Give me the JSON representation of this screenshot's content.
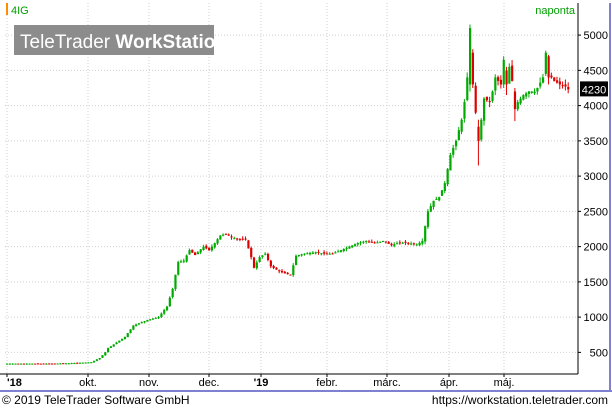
{
  "chart_data": {
    "type": "candlestick",
    "symbol": "4IG",
    "interval": "naponta",
    "watermark": {
      "brand_light": "TeleTrader ",
      "brand_bold": "WorkStation"
    },
    "last_value_label": "4230",
    "ylim": [
      250,
      5200
    ],
    "y_ticks": [
      500,
      1000,
      1500,
      2000,
      2500,
      3000,
      3500,
      4000,
      4500,
      5000
    ],
    "x_ticks": [
      {
        "label": "'18",
        "bold": true,
        "month_index": 0
      },
      {
        "label": "okt.",
        "bold": false,
        "month_index": 1
      },
      {
        "label": "nov.",
        "bold": false,
        "month_index": 2
      },
      {
        "label": "dec.",
        "bold": false,
        "month_index": 3
      },
      {
        "label": "'19",
        "bold": true,
        "month_index": 4
      },
      {
        "label": "febr.",
        "bold": false,
        "month_index": 5
      },
      {
        "label": "márc.",
        "bold": false,
        "month_index": 6
      },
      {
        "label": "ápr.",
        "bold": false,
        "month_index": 7
      },
      {
        "label": "máj.",
        "bold": false,
        "month_index": 8
      }
    ],
    "close_path": [
      [
        0,
        340
      ],
      [
        14,
        340
      ],
      [
        22,
        345
      ],
      [
        30,
        360
      ],
      [
        33,
        420
      ],
      [
        35,
        500
      ],
      [
        36,
        560
      ],
      [
        39,
        640
      ],
      [
        42,
        720
      ],
      [
        45,
        880
      ],
      [
        50,
        960
      ],
      [
        54,
        1000
      ],
      [
        57,
        1150
      ],
      [
        59,
        1400
      ],
      [
        60,
        1600
      ],
      [
        61,
        1780
      ],
      [
        63,
        1800
      ],
      [
        65,
        1950
      ],
      [
        67,
        1880
      ],
      [
        70,
        2000
      ],
      [
        72,
        1950
      ],
      [
        74,
        2050
      ],
      [
        76,
        2160
      ],
      [
        78,
        2180
      ],
      [
        80,
        2130
      ],
      [
        83,
        2100
      ],
      [
        85,
        2100
      ],
      [
        87,
        1850
      ],
      [
        88,
        1700
      ],
      [
        90,
        1850
      ],
      [
        92,
        1900
      ],
      [
        94,
        1720
      ],
      [
        97,
        1650
      ],
      [
        99,
        1620
      ],
      [
        101,
        1600
      ],
      [
        103,
        1870
      ],
      [
        106,
        1900
      ],
      [
        110,
        1920
      ],
      [
        113,
        1900
      ],
      [
        116,
        1900
      ],
      [
        119,
        1950
      ],
      [
        122,
        2000
      ],
      [
        125,
        2050
      ],
      [
        128,
        2080
      ],
      [
        131,
        2050
      ],
      [
        134,
        2080
      ],
      [
        137,
        2020
      ],
      [
        140,
        2060
      ],
      [
        143,
        2050
      ],
      [
        146,
        2030
      ],
      [
        148,
        2080
      ],
      [
        150,
        2500
      ],
      [
        152,
        2650
      ],
      [
        154,
        2700
      ],
      [
        156,
        2900
      ],
      [
        158,
        3300
      ],
      [
        160,
        3500
      ],
      [
        162,
        3800
      ],
      [
        163,
        4050
      ],
      [
        164,
        4400
      ],
      [
        165,
        4700
      ],
      [
        166,
        4300
      ],
      [
        167,
        3900
      ],
      [
        168,
        3550
      ],
      [
        169,
        3800
      ],
      [
        170,
        4100
      ],
      [
        172,
        4050
      ],
      [
        173,
        4200
      ],
      [
        174,
        4400
      ],
      [
        176,
        4300
      ],
      [
        177,
        4450
      ],
      [
        178,
        4400
      ],
      [
        179,
        4550
      ],
      [
        180,
        4350
      ],
      [
        181,
        4100
      ],
      [
        182,
        4050
      ],
      [
        184,
        4150
      ],
      [
        186,
        4200
      ],
      [
        188,
        4200
      ],
      [
        189,
        4250
      ],
      [
        191,
        4400
      ],
      [
        192,
        4600
      ],
      [
        193,
        4450
      ],
      [
        195,
        4350
      ],
      [
        197,
        4300
      ],
      [
        199,
        4270
      ],
      [
        200,
        4230
      ]
    ],
    "spikes": [
      {
        "day": 165,
        "open": 4300,
        "close": 5100,
        "high": 5150,
        "low": 4200
      },
      {
        "day": 166,
        "open": 4750,
        "close": 4300,
        "high": 4800,
        "low": 4250
      },
      {
        "day": 168,
        "open": 3700,
        "close": 3500,
        "high": 3800,
        "low": 3150
      },
      {
        "day": 177,
        "open": 4300,
        "close": 4650,
        "high": 4700,
        "low": 4250
      },
      {
        "day": 178,
        "open": 4500,
        "close": 4300,
        "high": 4550,
        "low": 4150
      },
      {
        "day": 181,
        "open": 4200,
        "close": 3950,
        "high": 4250,
        "low": 3780
      },
      {
        "day": 192,
        "open": 4450,
        "close": 4750,
        "high": 4780,
        "low": 4420
      },
      {
        "day": 193,
        "open": 4700,
        "close": 4400,
        "high": 4720,
        "low": 4300
      }
    ],
    "colors": {
      "up": "#00aa00",
      "down": "#dd0000",
      "grid": "#cfcfcf",
      "axis": "#000000",
      "symbol": "#ff8c00",
      "interval": "#00a000",
      "border": "#0000a0"
    }
  },
  "footer": {
    "copyright": "© 2019 TeleTrader Software GmbH",
    "url": "https://workstation.teletrader.com"
  }
}
